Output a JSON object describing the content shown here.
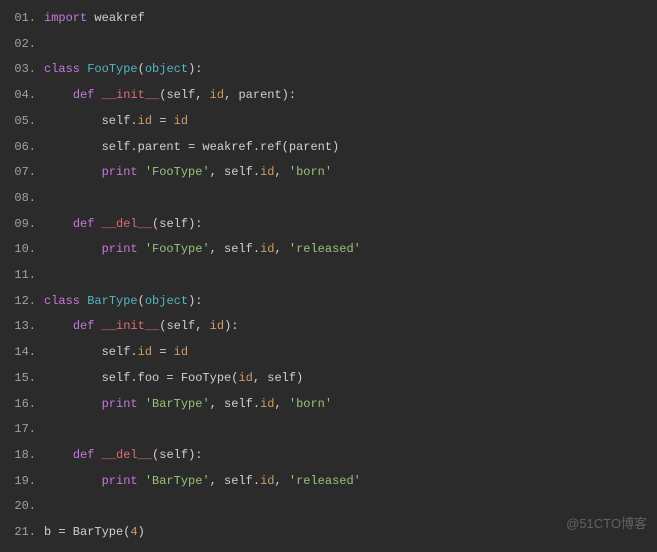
{
  "watermark": "@51CTO博客",
  "lines": [
    {
      "n": "01.",
      "tokens": [
        {
          "t": "import",
          "c": "kw"
        },
        {
          "t": " weakref",
          "c": "plain"
        }
      ]
    },
    {
      "n": "02.",
      "tokens": []
    },
    {
      "n": "03.",
      "tokens": [
        {
          "t": "class",
          "c": "kw"
        },
        {
          "t": " ",
          "c": "plain"
        },
        {
          "t": "FooType",
          "c": "cls"
        },
        {
          "t": "(",
          "c": "punct"
        },
        {
          "t": "object",
          "c": "builtin"
        },
        {
          "t": "):",
          "c": "punct"
        }
      ]
    },
    {
      "n": "04.",
      "tokens": [
        {
          "t": "    ",
          "c": "plain"
        },
        {
          "t": "def",
          "c": "kw"
        },
        {
          "t": " ",
          "c": "plain"
        },
        {
          "t": "__init__",
          "c": "magic"
        },
        {
          "t": "(",
          "c": "punct"
        },
        {
          "t": "self",
          "c": "self"
        },
        {
          "t": ", ",
          "c": "punct"
        },
        {
          "t": "id",
          "c": "idp"
        },
        {
          "t": ", parent",
          "c": "param"
        },
        {
          "t": "):",
          "c": "punct"
        }
      ]
    },
    {
      "n": "05.",
      "tokens": [
        {
          "t": "        self.",
          "c": "plain"
        },
        {
          "t": "id",
          "c": "idp"
        },
        {
          "t": " = ",
          "c": "plain"
        },
        {
          "t": "id",
          "c": "idp"
        }
      ]
    },
    {
      "n": "06.",
      "tokens": [
        {
          "t": "        self.parent = weakref.ref(parent)",
          "c": "plain"
        }
      ]
    },
    {
      "n": "07.",
      "tokens": [
        {
          "t": "        ",
          "c": "plain"
        },
        {
          "t": "print",
          "c": "kw"
        },
        {
          "t": " ",
          "c": "plain"
        },
        {
          "t": "'FooType'",
          "c": "str"
        },
        {
          "t": ", self.",
          "c": "plain"
        },
        {
          "t": "id",
          "c": "idp"
        },
        {
          "t": ", ",
          "c": "plain"
        },
        {
          "t": "'born'",
          "c": "str"
        }
      ]
    },
    {
      "n": "08.",
      "tokens": []
    },
    {
      "n": "09.",
      "tokens": [
        {
          "t": "    ",
          "c": "plain"
        },
        {
          "t": "def",
          "c": "kw"
        },
        {
          "t": " ",
          "c": "plain"
        },
        {
          "t": "__del__",
          "c": "magic"
        },
        {
          "t": "(",
          "c": "punct"
        },
        {
          "t": "self",
          "c": "self"
        },
        {
          "t": "):",
          "c": "punct"
        }
      ]
    },
    {
      "n": "10.",
      "tokens": [
        {
          "t": "        ",
          "c": "plain"
        },
        {
          "t": "print",
          "c": "kw"
        },
        {
          "t": " ",
          "c": "plain"
        },
        {
          "t": "'FooType'",
          "c": "str"
        },
        {
          "t": ", self.",
          "c": "plain"
        },
        {
          "t": "id",
          "c": "idp"
        },
        {
          "t": ", ",
          "c": "plain"
        },
        {
          "t": "'released'",
          "c": "str"
        }
      ]
    },
    {
      "n": "11.",
      "tokens": []
    },
    {
      "n": "12.",
      "tokens": [
        {
          "t": "class",
          "c": "kw"
        },
        {
          "t": " ",
          "c": "plain"
        },
        {
          "t": "BarType",
          "c": "cls"
        },
        {
          "t": "(",
          "c": "punct"
        },
        {
          "t": "object",
          "c": "builtin"
        },
        {
          "t": "):",
          "c": "punct"
        }
      ]
    },
    {
      "n": "13.",
      "tokens": [
        {
          "t": "    ",
          "c": "plain"
        },
        {
          "t": "def",
          "c": "kw"
        },
        {
          "t": " ",
          "c": "plain"
        },
        {
          "t": "__init__",
          "c": "magic"
        },
        {
          "t": "(",
          "c": "punct"
        },
        {
          "t": "self",
          "c": "self"
        },
        {
          "t": ", ",
          "c": "punct"
        },
        {
          "t": "id",
          "c": "idp"
        },
        {
          "t": "):",
          "c": "punct"
        }
      ]
    },
    {
      "n": "14.",
      "tokens": [
        {
          "t": "        self.",
          "c": "plain"
        },
        {
          "t": "id",
          "c": "idp"
        },
        {
          "t": " = ",
          "c": "plain"
        },
        {
          "t": "id",
          "c": "idp"
        }
      ]
    },
    {
      "n": "15.",
      "tokens": [
        {
          "t": "        self.foo = FooType(",
          "c": "plain"
        },
        {
          "t": "id",
          "c": "idp"
        },
        {
          "t": ", self)",
          "c": "plain"
        }
      ]
    },
    {
      "n": "16.",
      "tokens": [
        {
          "t": "        ",
          "c": "plain"
        },
        {
          "t": "print",
          "c": "kw"
        },
        {
          "t": " ",
          "c": "plain"
        },
        {
          "t": "'BarType'",
          "c": "str"
        },
        {
          "t": ", self.",
          "c": "plain"
        },
        {
          "t": "id",
          "c": "idp"
        },
        {
          "t": ", ",
          "c": "plain"
        },
        {
          "t": "'born'",
          "c": "str"
        }
      ]
    },
    {
      "n": "17.",
      "tokens": []
    },
    {
      "n": "18.",
      "tokens": [
        {
          "t": "    ",
          "c": "plain"
        },
        {
          "t": "def",
          "c": "kw"
        },
        {
          "t": " ",
          "c": "plain"
        },
        {
          "t": "__del__",
          "c": "magic"
        },
        {
          "t": "(",
          "c": "punct"
        },
        {
          "t": "self",
          "c": "self"
        },
        {
          "t": "):",
          "c": "punct"
        }
      ]
    },
    {
      "n": "19.",
      "tokens": [
        {
          "t": "        ",
          "c": "plain"
        },
        {
          "t": "print",
          "c": "kw"
        },
        {
          "t": " ",
          "c": "plain"
        },
        {
          "t": "'BarType'",
          "c": "str"
        },
        {
          "t": ", self.",
          "c": "plain"
        },
        {
          "t": "id",
          "c": "idp"
        },
        {
          "t": ", ",
          "c": "plain"
        },
        {
          "t": "'released'",
          "c": "str"
        }
      ]
    },
    {
      "n": "20.",
      "tokens": []
    },
    {
      "n": "21.",
      "tokens": [
        {
          "t": "b = BarType(",
          "c": "plain"
        },
        {
          "t": "4",
          "c": "num"
        },
        {
          "t": ")",
          "c": "plain"
        }
      ]
    }
  ]
}
